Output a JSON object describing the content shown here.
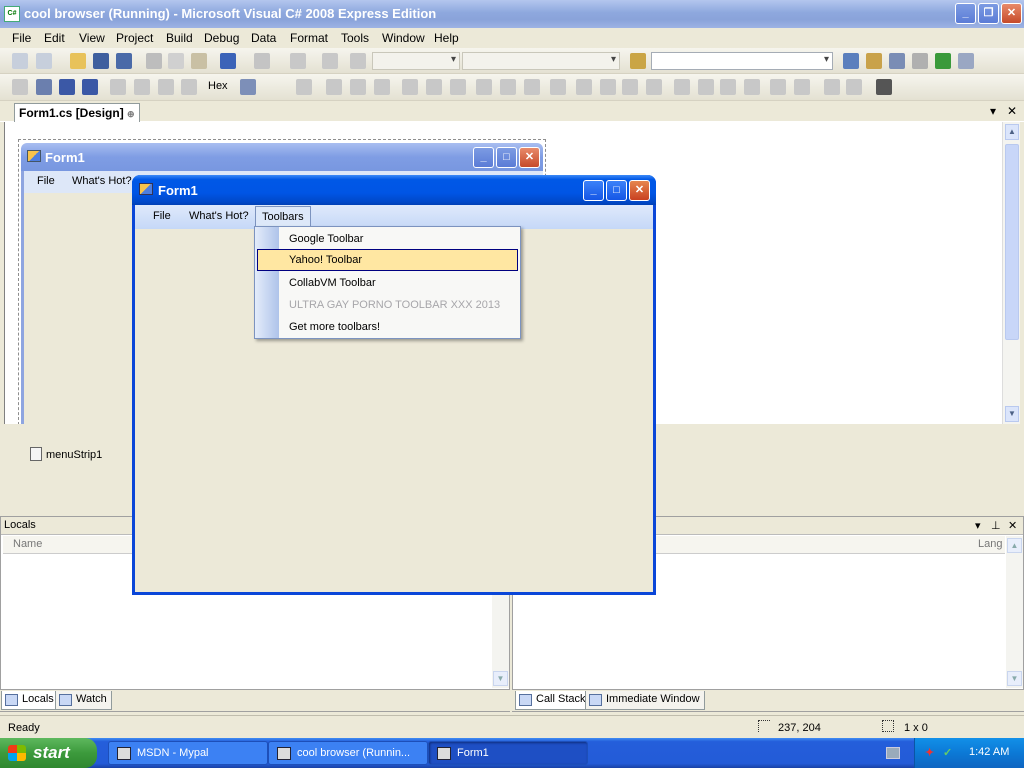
{
  "vs": {
    "title": "cool browser (Running) - Microsoft Visual C# 2008 Express Edition",
    "app_icon_text": "C#",
    "menu": [
      "File",
      "Edit",
      "View",
      "Project",
      "Build",
      "Debug",
      "Data",
      "Format",
      "Tools",
      "Window",
      "Help"
    ],
    "toolbar_hex_label": "Hex",
    "doc_tab": "Form1.cs [Design]",
    "pin_glyph": "⊕",
    "tray_component": "menuStrip1"
  },
  "design_form": {
    "title": "Form1",
    "menu": [
      "File",
      "What's Hot?"
    ]
  },
  "locals": {
    "title": "Locals",
    "column": "Name",
    "tabs": [
      "Locals",
      "Watch"
    ]
  },
  "callstack": {
    "column": "Lang",
    "tabs": [
      "Call Stack",
      "Immediate Window"
    ]
  },
  "status": {
    "ready": "Ready",
    "position": "237, 204",
    "size": "1 x 0"
  },
  "form1": {
    "title": "Form1",
    "menu": [
      "File",
      "What's Hot?",
      "Toolbars"
    ],
    "dropdown": [
      {
        "label": "Google Toolbar",
        "state": "normal"
      },
      {
        "label": "Yahoo! Toolbar",
        "state": "hover"
      },
      {
        "label": "CollabVM Toolbar",
        "state": "normal"
      },
      {
        "label": "ULTRA GAY PORNO TOOLBAR XXX 2013",
        "state": "disabled"
      },
      {
        "label": "Get more toolbars!",
        "state": "normal"
      }
    ]
  },
  "taskbar": {
    "start_label": "start",
    "tasks": [
      {
        "label": "MSDN - Mypal",
        "active": false
      },
      {
        "label": "cool browser (Runnin...",
        "active": false
      },
      {
        "label": "Form1",
        "active": true
      }
    ],
    "clock": "1:42 AM"
  },
  "colors": {
    "xp_blue": "#0055e5",
    "menu_hover": "#ffe7a2",
    "start_green": "#3c9a3c"
  }
}
